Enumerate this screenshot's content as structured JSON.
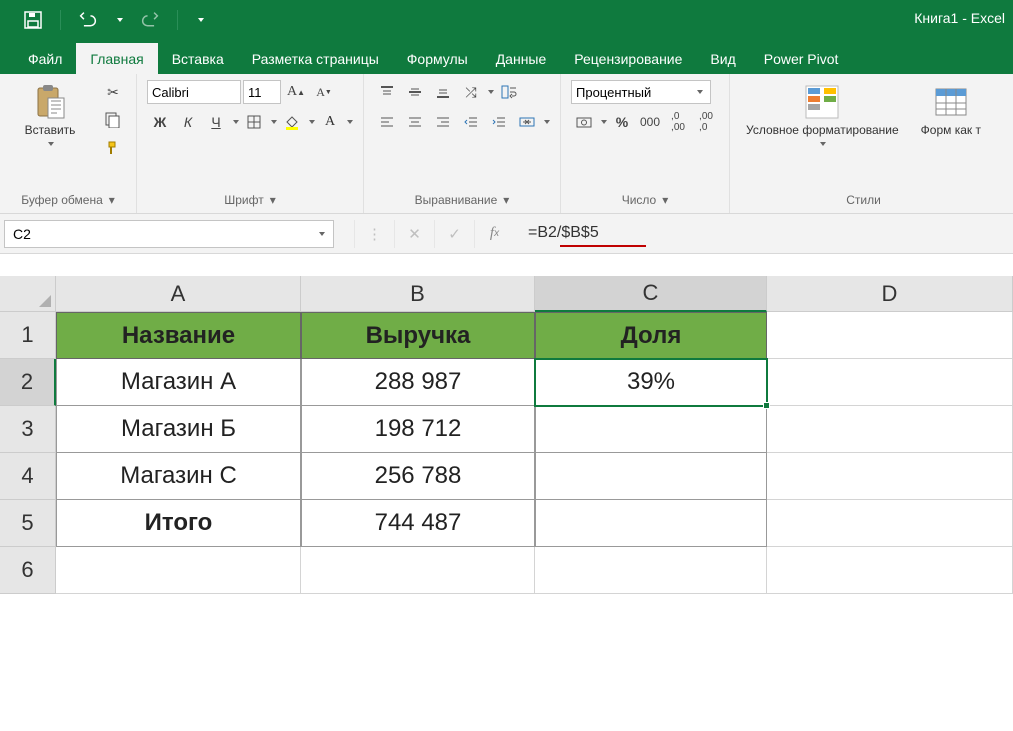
{
  "app": {
    "title": "Книга1 - Excel"
  },
  "qat": {
    "save_icon": "save",
    "undo_icon": "undo",
    "redo_icon": "redo"
  },
  "tabs": [
    "Файл",
    "Главная",
    "Вставка",
    "Разметка страницы",
    "Формулы",
    "Данные",
    "Рецензирование",
    "Вид",
    "Power Pivot"
  ],
  "active_tab": "Главная",
  "ribbon": {
    "clipboard": {
      "paste": "Вставить",
      "label": "Буфер обмена"
    },
    "font": {
      "family": "Calibri",
      "size": "11",
      "bold": "Ж",
      "italic": "К",
      "underline": "Ч",
      "label": "Шрифт"
    },
    "align": {
      "label": "Выравнивание"
    },
    "number": {
      "format": "Процентный",
      "label": "Число"
    },
    "styles": {
      "cond": "Условное форматирование",
      "fmt_as": "Форм как т",
      "label": "Стили"
    }
  },
  "namebox": "C2",
  "formula": "=B2/$B$5",
  "columns": [
    "A",
    "B",
    "C",
    "D"
  ],
  "rows": [
    "1",
    "2",
    "3",
    "4",
    "5",
    "6"
  ],
  "selected_col": "C",
  "selected_row": "2",
  "table": {
    "headers": {
      "A": "Название",
      "B": "Выручка",
      "C": "Доля"
    },
    "r2": {
      "A": "Магазин А",
      "B": "288 987",
      "C": "39%"
    },
    "r3": {
      "A": "Магазин Б",
      "B": "198 712",
      "C": ""
    },
    "r4": {
      "A": "Магазин С",
      "B": "256 788",
      "C": ""
    },
    "r5": {
      "A": "Итого",
      "B": "744 487",
      "C": ""
    }
  }
}
